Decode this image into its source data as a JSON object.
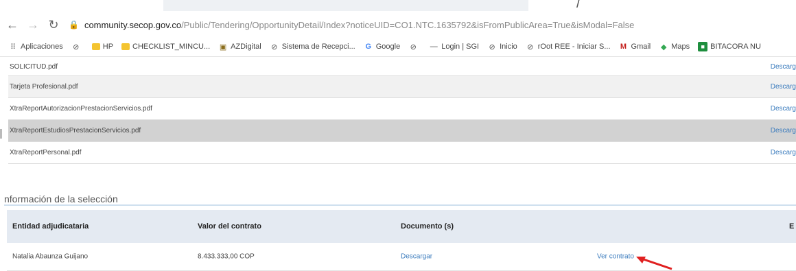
{
  "browser": {
    "url_host": "community.secop.gov.co",
    "url_path": "/Public/Tendering/OpportunityDetail/Index?noticeUID=CO1.NTC.1635792&isFromPublicArea=True&isModal=False",
    "bookmarks": [
      {
        "label": "Aplicaciones",
        "icon": "apps-icon"
      },
      {
        "label": "",
        "icon": "globe-icon"
      },
      {
        "label": "HP",
        "icon": "folder-icon"
      },
      {
        "label": "CHECKLIST_MINCU...",
        "icon": "folder-icon"
      },
      {
        "label": "AZDigital",
        "icon": "azdigital-icon"
      },
      {
        "label": "Sistema de Recepci...",
        "icon": "globe-icon"
      },
      {
        "label": "Google",
        "icon": "google-icon"
      },
      {
        "label": "",
        "icon": "globe-icon"
      },
      {
        "label": "Login | SGI",
        "icon": "login-icon"
      },
      {
        "label": "Inicio",
        "icon": "globe-icon"
      },
      {
        "label": "rOot REE - Iniciar S...",
        "icon": "globe-icon"
      },
      {
        "label": "Gmail",
        "icon": "gmail-icon"
      },
      {
        "label": "Maps",
        "icon": "maps-icon"
      },
      {
        "label": "BITACORA NU",
        "icon": "bitacora-icon"
      }
    ]
  },
  "documents": {
    "rows": [
      {
        "name": "SOLICITUD.pdf",
        "action": "Descarg"
      },
      {
        "name": "Tarjeta Profesional.pdf",
        "action": "Descarg"
      },
      {
        "name": "XtraReportAutorizacionPrestacionServicios.pdf",
        "action": "Descarg"
      },
      {
        "name": "XtraReportEstudiosPrestacionServicios.pdf",
        "action": "Descarg"
      },
      {
        "name": "XtraReportPersonal.pdf",
        "action": "Descarg"
      }
    ]
  },
  "selection": {
    "title": "nformación de la selección",
    "headers": [
      "Entidad adjudicataria",
      "Valor del contrato",
      "Documento (s)",
      "",
      "E"
    ],
    "row": {
      "entity": "Natalia Abaunza Guijano",
      "value": "8.433.333,00 COP",
      "document_link": "Descargar",
      "contract_link": "Ver contrato"
    }
  },
  "colors": {
    "link": "#3a7bbd",
    "header_bg": "#e4eaf2",
    "arrow": "#e02020"
  }
}
